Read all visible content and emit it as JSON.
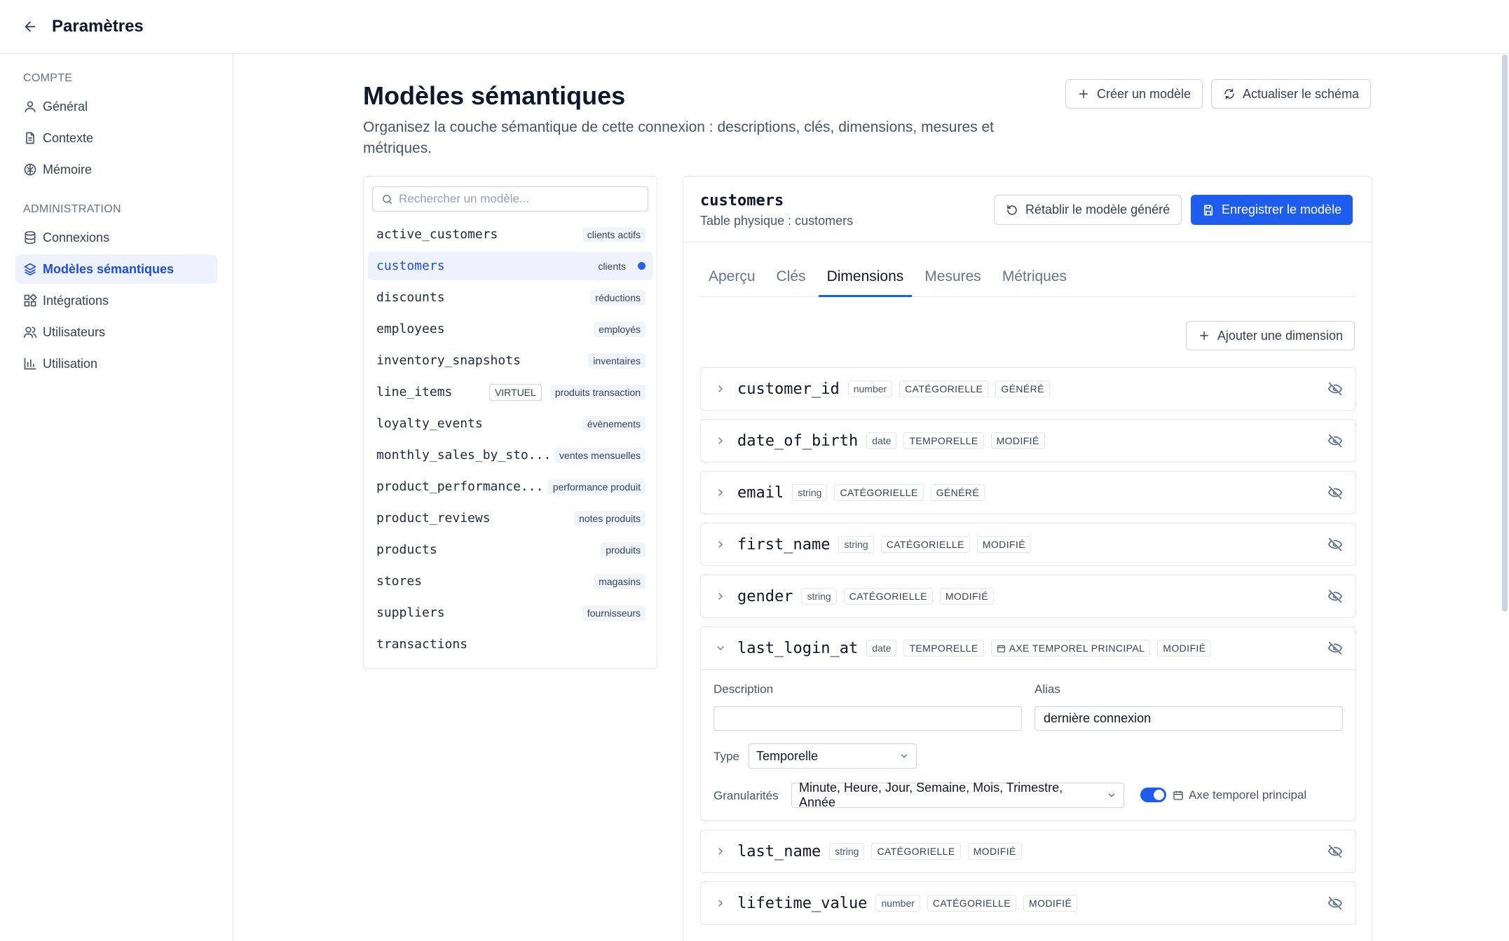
{
  "header": {
    "title": "Paramètres"
  },
  "sidebar": {
    "sections": [
      {
        "label": "COMPTE",
        "items": [
          {
            "label": "Général",
            "icon": "user-icon"
          },
          {
            "label": "Contexte",
            "icon": "document-icon"
          },
          {
            "label": "Mémoire",
            "icon": "brain-icon"
          }
        ]
      },
      {
        "label": "ADMINISTRATION",
        "items": [
          {
            "label": "Connexions",
            "icon": "database-icon"
          },
          {
            "label": "Modèles sémantiques",
            "icon": "layers-icon",
            "active": true
          },
          {
            "label": "Intégrations",
            "icon": "puzzle-icon"
          },
          {
            "label": "Utilisateurs",
            "icon": "users-icon"
          },
          {
            "label": "Utilisation",
            "icon": "bar-chart-icon"
          }
        ]
      }
    ]
  },
  "page": {
    "title": "Modèles sémantiques",
    "description": "Organisez la couche sémantique de cette connexion : descriptions, clés, dimensions, mesures et métriques.",
    "create_label": "Créer un modèle",
    "refresh_label": "Actualiser le schéma"
  },
  "model_list": {
    "search_placeholder": "Rechercher un modèle...",
    "models": [
      {
        "name": "active_customers",
        "alias": "clients actifs"
      },
      {
        "name": "customers",
        "alias": "clients",
        "active": true
      },
      {
        "name": "discounts",
        "alias": "réductions"
      },
      {
        "name": "employees",
        "alias": "employés"
      },
      {
        "name": "inventory_snapshots",
        "alias": "inventaires"
      },
      {
        "name": "line_items",
        "alias": "produits transaction",
        "tag": "VIRTUEL"
      },
      {
        "name": "loyalty_events",
        "alias": "évènements"
      },
      {
        "name": "monthly_sales_by_sto...",
        "alias": "ventes mensuelles"
      },
      {
        "name": "product_performance...",
        "alias": "performance produit"
      },
      {
        "name": "product_reviews",
        "alias": "notes produits"
      },
      {
        "name": "products",
        "alias": "produits"
      },
      {
        "name": "stores",
        "alias": "magasins"
      },
      {
        "name": "suppliers",
        "alias": "fournisseurs"
      },
      {
        "name": "transactions",
        "alias": ""
      }
    ]
  },
  "detail": {
    "model_name": "customers",
    "physical_table": "Table physique : customers",
    "reset_label": "Rétablir le modèle généré",
    "save_label": "Enregistrer le modèle",
    "tabs": [
      "Aperçu",
      "Clés",
      "Dimensions",
      "Mesures",
      "Métriques"
    ],
    "active_tab": "Dimensions",
    "add_dimension_label": "Ajouter une dimension",
    "dimensions": [
      {
        "name": "customer_id",
        "type": "number",
        "kind": "CATÉGORIELLE",
        "status": "GÉNÉRÉ"
      },
      {
        "name": "date_of_birth",
        "type": "date",
        "kind": "TEMPORELLE",
        "status": "MODIFIÉ"
      },
      {
        "name": "email",
        "type": "string",
        "kind": "CATÉGORIELLE",
        "status": "GÉNÉRÉ"
      },
      {
        "name": "first_name",
        "type": "string",
        "kind": "CATÉGORIELLE",
        "status": "MODIFIÉ"
      },
      {
        "name": "gender",
        "type": "string",
        "kind": "CATÉGORIELLE",
        "status": "MODIFIÉ"
      },
      {
        "name": "last_login_at",
        "type": "date",
        "kind": "TEMPORELLE",
        "primary": "AXE TEMPOREL PRINCIPAL",
        "status": "MODIFIÉ",
        "expanded": true
      },
      {
        "name": "last_name",
        "type": "string",
        "kind": "CATÉGORIELLE",
        "status": "MODIFIÉ"
      },
      {
        "name": "lifetime_value",
        "type": "number",
        "kind": "CATÉGORIELLE",
        "status": "MODIFIÉ"
      }
    ],
    "expanded": {
      "description_label": "Description",
      "description_value": "",
      "alias_label": "Alias",
      "alias_value": "dernière connexion",
      "type_label": "Type",
      "type_value": "Temporelle",
      "granularities_label": "Granularités",
      "granularities_value": "Minute, Heure, Jour, Semaine, Mois, Trimestre, Année",
      "primary_axis_label": "Axe temporel principal",
      "primary_axis_on": true
    }
  },
  "colors": {
    "accent": "#1d5ced",
    "active_bg": "#eef2ff",
    "border": "#e5e7eb"
  }
}
